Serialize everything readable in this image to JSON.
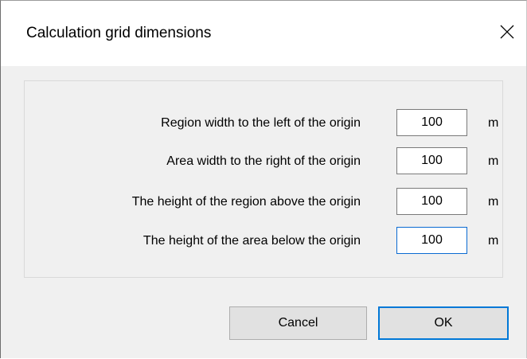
{
  "window": {
    "title": "Calculation grid dimensions",
    "close_icon": "close-icon"
  },
  "rows": [
    {
      "label": "Region width to the left of the origin",
      "value": "100",
      "unit": "m"
    },
    {
      "label": "Area width to the right of the origin",
      "value": "100",
      "unit": "m"
    },
    {
      "label": "The height of the region above the origin",
      "value": "100",
      "unit": "m"
    },
    {
      "label": "The height of the area below the origin",
      "value": "100",
      "unit": "m"
    }
  ],
  "buttons": {
    "cancel_label": "Cancel",
    "ok_label": "OK"
  },
  "colors": {
    "focus_border": "#0a6ad2",
    "default_button_border": "#0078d7",
    "dialog_background": "#f0f0f0"
  }
}
